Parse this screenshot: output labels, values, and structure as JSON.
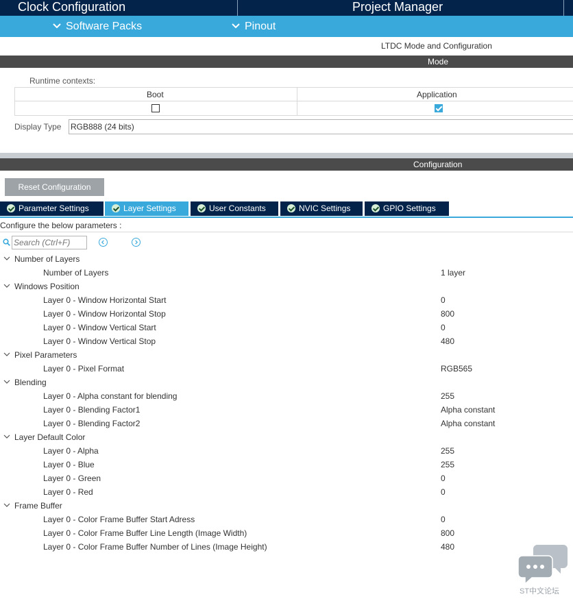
{
  "topnav": {
    "clock_configuration": "Clock Configuration",
    "project_manager": "Project Manager"
  },
  "subnav": {
    "software_packs": "Software Packs",
    "pinout": "Pinout"
  },
  "section_title": "LTDC Mode and Configuration",
  "mode": {
    "header": "Mode",
    "runtime_contexts_label": "Runtime contexts:",
    "contexts": [
      {
        "label": "Boot",
        "checked": false
      },
      {
        "label": "Application",
        "checked": true
      }
    ],
    "display_type_label": "Display Type",
    "display_type_value": "RGB888 (24 bits)"
  },
  "configuration": {
    "header": "Configuration",
    "reset_button": "Reset Configuration",
    "tabs": [
      {
        "label": "Parameter Settings",
        "active": false
      },
      {
        "label": "Layer Settings",
        "active": true
      },
      {
        "label": "User Constants",
        "active": false
      },
      {
        "label": "NVIC Settings",
        "active": false
      },
      {
        "label": "GPIO Settings",
        "active": false
      }
    ],
    "configure_label": "Configure the below parameters :",
    "search_placeholder": "Search (Ctrl+F)"
  },
  "groups": [
    {
      "name": "Number of Layers",
      "params": [
        {
          "name": "Number of Layers",
          "value": "1 layer"
        }
      ]
    },
    {
      "name": "Windows Position",
      "params": [
        {
          "name": "Layer 0 - Window Horizontal Start",
          "value": "0"
        },
        {
          "name": "Layer 0 - Window Horizontal Stop",
          "value": "800"
        },
        {
          "name": "Layer 0 - Window Vertical Start",
          "value": "0"
        },
        {
          "name": "Layer 0 - Window Vertical Stop",
          "value": "480"
        }
      ]
    },
    {
      "name": "Pixel Parameters",
      "params": [
        {
          "name": "Layer 0 - Pixel Format",
          "value": "RGB565"
        }
      ]
    },
    {
      "name": "Blending",
      "params": [
        {
          "name": "Layer 0 - Alpha constant for blending",
          "value": "255"
        },
        {
          "name": "Layer 0 - Blending Factor1",
          "value": "Alpha constant"
        },
        {
          "name": "Layer 0 - Blending Factor2",
          "value": "Alpha constant"
        }
      ]
    },
    {
      "name": "Layer Default Color",
      "params": [
        {
          "name": "Layer 0 - Alpha",
          "value": "255"
        },
        {
          "name": "Layer 0 - Blue",
          "value": "255"
        },
        {
          "name": "Layer 0 - Green",
          "value": "0"
        },
        {
          "name": "Layer 0 - Red",
          "value": "0"
        }
      ]
    },
    {
      "name": "Frame Buffer",
      "params": [
        {
          "name": "Layer 0 - Color Frame Buffer Start Adress",
          "value": "0"
        },
        {
          "name": "Layer 0 - Color Frame Buffer Line Length (Image Width)",
          "value": "800"
        },
        {
          "name": "Layer 0 - Color Frame Buffer Number of Lines (Image Height)",
          "value": "480"
        }
      ]
    }
  ],
  "watermark": {
    "text": "ST中文论坛",
    "icon": "chat-bubbles-icon"
  },
  "colors": {
    "navy": "#03234b",
    "accent_blue": "#39a9dc",
    "dark_gray_band": "#4b4b4b",
    "button_gray": "#9ea3a8"
  }
}
